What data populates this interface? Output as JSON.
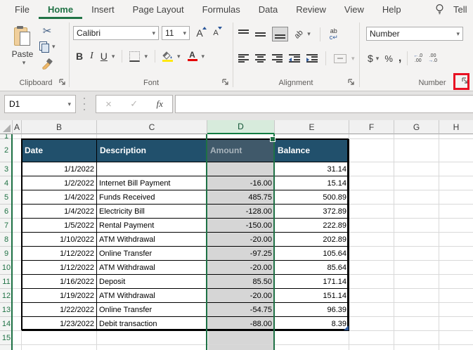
{
  "tabs": {
    "items": [
      "File",
      "Home",
      "Insert",
      "Page Layout",
      "Formulas",
      "Data",
      "Review",
      "View",
      "Help"
    ],
    "active": "Home",
    "tell_label": "Tell"
  },
  "ribbon": {
    "clipboard": {
      "label": "Clipboard",
      "paste_label": "Paste"
    },
    "font": {
      "label": "Font",
      "font_name": "Calibri",
      "font_size": "11",
      "bold": "B",
      "italic": "I",
      "underline": "U",
      "grow_letter": "A",
      "shrink_letter": "A",
      "color_letter": "A"
    },
    "alignment": {
      "label": "Alignment",
      "orientation_text": "ab",
      "wrap_line1": "ab",
      "wrap_line2": "c↵"
    },
    "number": {
      "label": "Number",
      "format_value": "Number",
      "currency": "$",
      "percent": "%",
      "comma": ",",
      "inc_decimal": "←.0\n.00",
      "dec_decimal": ".00\n→.0"
    }
  },
  "formula_bar": {
    "name_box_value": "D1",
    "cancel_glyph": "×",
    "enter_glyph": "✓",
    "fx_label": "fx",
    "formula_value": ""
  },
  "icons": {
    "dropdown": "▾",
    "scissors": "✂",
    "lightbulb": "lightbulb-outline",
    "dialog_launcher": "corner-arrow",
    "select_all": "triangle"
  },
  "colors": {
    "accent_green": "#217346",
    "marquee_green": "#1e7145",
    "table_header_blue": "#21506c",
    "selected_header_blue": "#40596a",
    "selection_gray": "#d6d6d6",
    "highlight_red": "#e81123",
    "selected_col_header_bg": "#d7ebdc",
    "fill_yellow": "#ffe812",
    "font_color_red": "#e40000"
  },
  "grid": {
    "columns": [
      "A",
      "B",
      "C",
      "D",
      "E",
      "F",
      "G",
      "H"
    ],
    "selected_column": "D",
    "active_cell": "D1",
    "row_numbers": [
      "1",
      "2",
      "3",
      "4",
      "5",
      "6",
      "7",
      "8",
      "9",
      "10",
      "11",
      "12",
      "13",
      "14",
      "15"
    ],
    "table": {
      "headers": [
        "Date",
        "Description",
        "Amount",
        "Balance"
      ],
      "rows": [
        [
          "1/1/2022",
          "",
          "",
          "31.14"
        ],
        [
          "1/2/2022",
          "Internet Bill Payment",
          "-16.00",
          "15.14"
        ],
        [
          "1/4/2022",
          "Funds Received",
          "485.75",
          "500.89"
        ],
        [
          "1/4/2022",
          "Electricity Bill",
          "-128.00",
          "372.89"
        ],
        [
          "1/5/2022",
          "Rental Payment",
          "-150.00",
          "222.89"
        ],
        [
          "1/10/2022",
          "ATM Withdrawal",
          "-20.00",
          "202.89"
        ],
        [
          "1/12/2022",
          "Online Transfer",
          "-97.25",
          "105.64"
        ],
        [
          "1/12/2022",
          "ATM Withdrawal",
          "-20.00",
          "85.64"
        ],
        [
          "1/16/2022",
          "Deposit",
          "85.50",
          "171.14"
        ],
        [
          "1/19/2022",
          "ATM Withdrawal",
          "-20.00",
          "151.14"
        ],
        [
          "1/22/2022",
          "Online Transfer",
          "-54.75",
          "96.39"
        ],
        [
          "1/23/2022",
          "Debit transaction",
          "-88.00",
          "8.39"
        ]
      ]
    }
  }
}
